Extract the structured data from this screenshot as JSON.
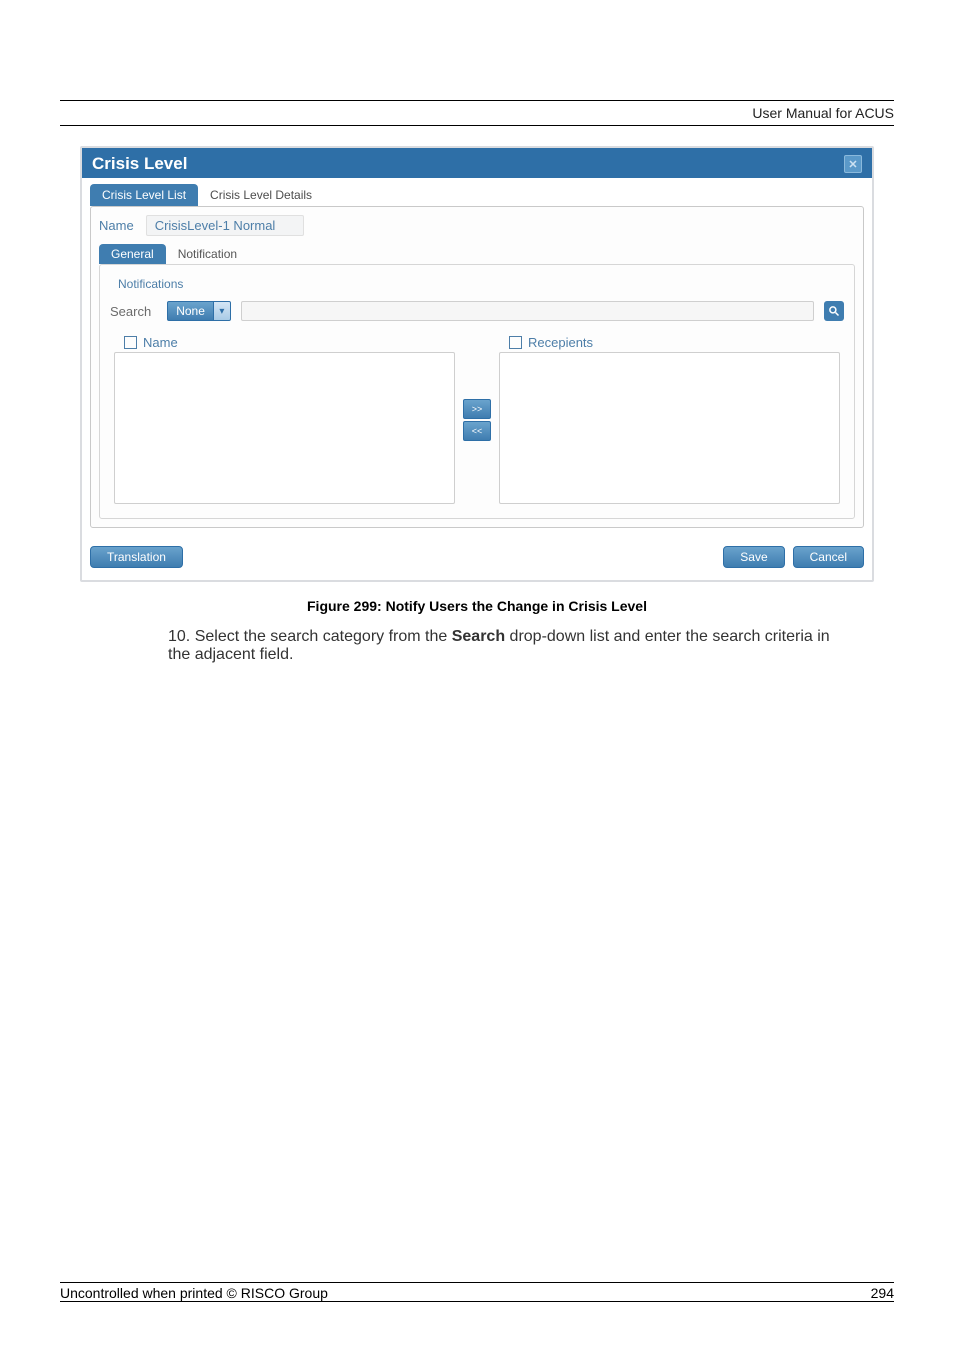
{
  "header": {
    "text": "User Manual for ACUS"
  },
  "dialog": {
    "title": "Crisis Level",
    "tabs": {
      "list": "Crisis Level List",
      "details": "Crisis Level Details"
    },
    "name_label": "Name",
    "name_value": "CrisisLevel-1  Normal",
    "inner_tabs": {
      "general": "General",
      "notification": "Notification"
    },
    "fieldset_title": "Notifications",
    "search_label": "Search",
    "search_dropdown": "None",
    "left_header": "Name",
    "right_header": "Recepients",
    "move_right": ">>",
    "move_left": "<<",
    "translation_btn": "Translation",
    "save_btn": "Save",
    "cancel_btn": "Cancel"
  },
  "caption": "Figure 299: Notify Users the Change in Crisis Level",
  "list_item": {
    "number": "10.",
    "pre": "Select the search category from the ",
    "bold": "Search",
    "post": " drop-down list and enter the search criteria in the adjacent field."
  },
  "footer": {
    "left": "Uncontrolled when printed © RISCO Group",
    "right": "294"
  }
}
